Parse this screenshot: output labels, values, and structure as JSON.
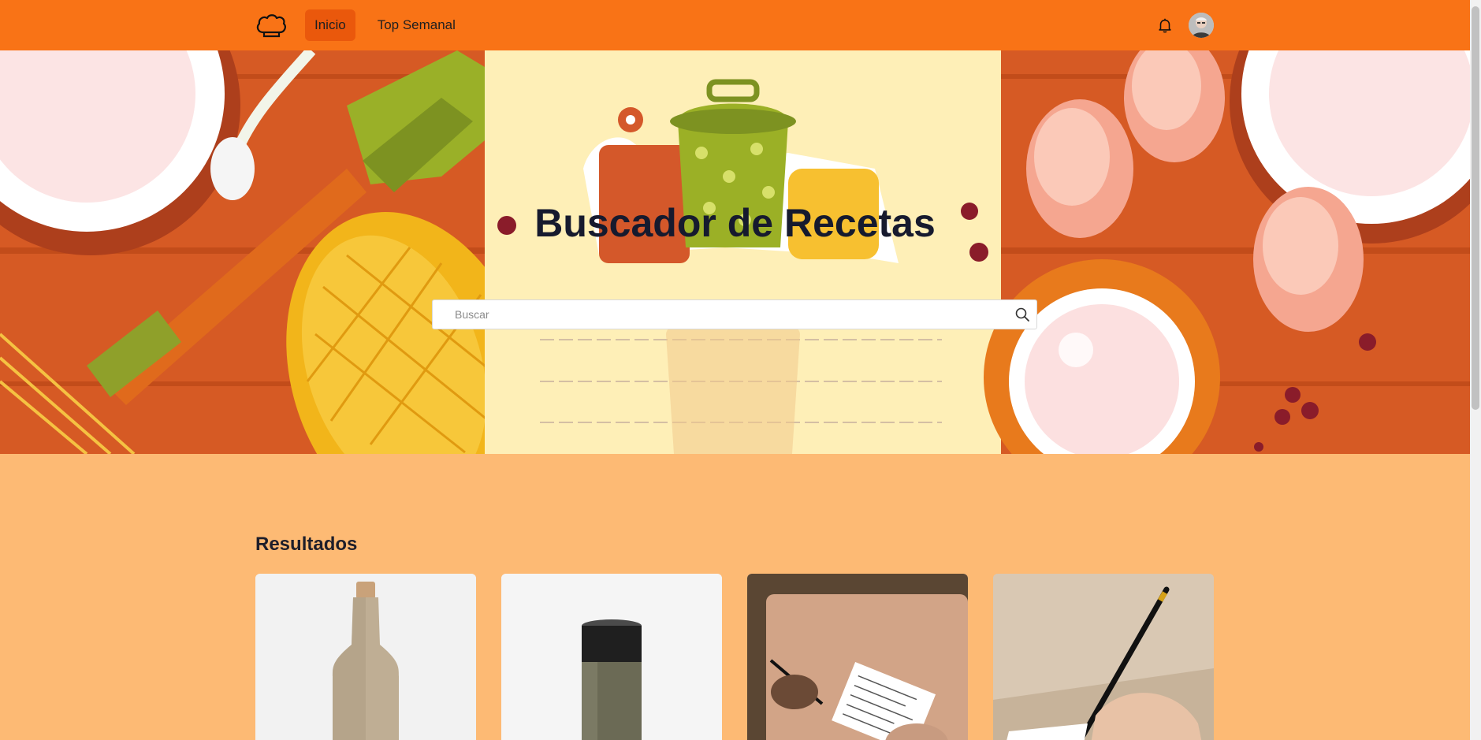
{
  "nav": {
    "logo_icon": "chef-hat-icon",
    "links": [
      {
        "label": "Inicio",
        "active": true
      },
      {
        "label": "Top Semanal",
        "active": false
      }
    ],
    "bell_icon": "bell-icon",
    "avatar_icon": "user-avatar"
  },
  "hero": {
    "title": "Buscador de Recetas",
    "search": {
      "placeholder": "Buscar",
      "value": "",
      "icon": "search-icon"
    }
  },
  "results": {
    "title": "Resultados",
    "cards": [
      {
        "image": "ceramic-bottle"
      },
      {
        "image": "travel-mug"
      },
      {
        "image": "notebook-writing"
      },
      {
        "image": "pen-in-hand"
      }
    ]
  },
  "colors": {
    "nav_bg": "#f97316",
    "nav_active": "#ea580c",
    "page_bg": "#fdba74",
    "title": "#161a2e"
  }
}
